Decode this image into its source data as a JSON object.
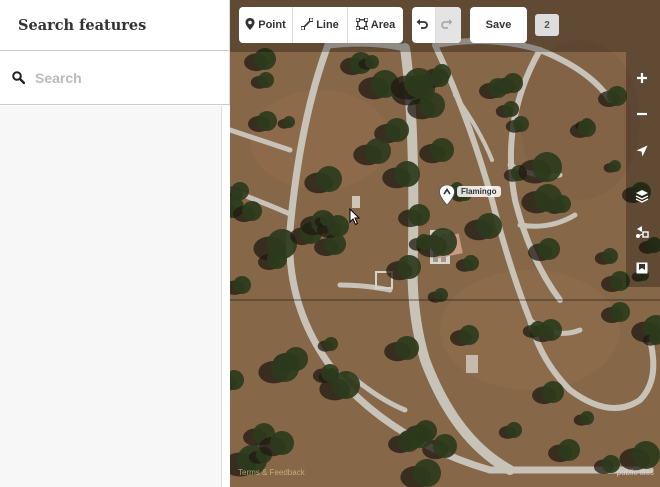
{
  "sidebar": {
    "title": "Search features",
    "search": {
      "placeholder": "Search",
      "value": ""
    }
  },
  "toolbar": {
    "point_label": "Point",
    "line_label": "Line",
    "area_label": "Area",
    "undo_icon": "undo-icon",
    "redo_icon": "redo-icon",
    "save_label": "Save",
    "edit_count": "2"
  },
  "map_controls": [
    "zoom-in-icon",
    "zoom-out-icon",
    "geolocate-icon",
    "layers-icon",
    "map-data-icon",
    "issues-icon"
  ],
  "map": {
    "feature_label": "Flamingo",
    "attribution": "Terms & Feedback",
    "tiles_credit": "public tiles"
  },
  "colors": {
    "ground": "#8a6a4a",
    "path": "#c9c4bb",
    "tree": "#2c3b1c",
    "shadow": "#1f1a12",
    "toolbar_bg": "#ffffff",
    "badge_bg": "#dddddd"
  }
}
